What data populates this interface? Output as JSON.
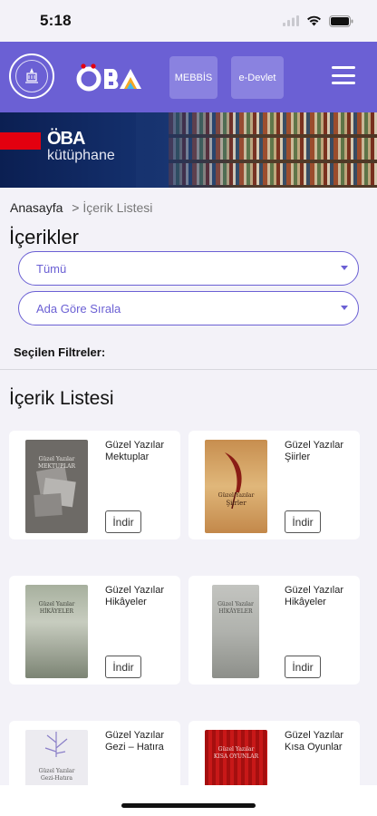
{
  "status": {
    "time": "5:18"
  },
  "header": {
    "mebbis": "MEBBİS",
    "edevlet": "e-Devlet",
    "logo": "ÖBA"
  },
  "banner": {
    "brand": "ÖBA",
    "sub": "kütüphane"
  },
  "breadcrumb": {
    "home": "Anasayfa",
    "sep": ">",
    "current": "İçerik Listesi"
  },
  "title": "İçerikler",
  "filters": {
    "category": "Tümü",
    "sort": "Ada Göre Sırala",
    "selected_label": "Seçilen Filtreler:"
  },
  "list_title": "İçerik Listesi",
  "download_label": "İndir",
  "books": [
    {
      "title": "Güzel Yazılar Mektuplar",
      "cover_top": "Güzel Yazılar",
      "cover_main": "MEKTUPLAR"
    },
    {
      "title": "Güzel Yazılar Şiirler",
      "cover_top": "Güzel Yazılar",
      "cover_main": "Şiirler"
    },
    {
      "title": "Güzel Yazılar Hikâyeler",
      "cover_top": "Güzel Yazılar",
      "cover_main": "HİKÂYELER"
    },
    {
      "title": "Güzel Yazılar Hikâyeler",
      "cover_top": "Güzel Yazılar",
      "cover_main": "HİKÂYELER"
    },
    {
      "title": "Güzel Yazılar Gezi – Hatıra",
      "cover_top": "Güzel Yazılar",
      "cover_main": "Gezi-Hatıra"
    },
    {
      "title": "Güzel Yazılar Kısa Oyunlar",
      "cover_top": "Güzel Yazılar",
      "cover_main": "KISA OYUNLAR"
    }
  ]
}
